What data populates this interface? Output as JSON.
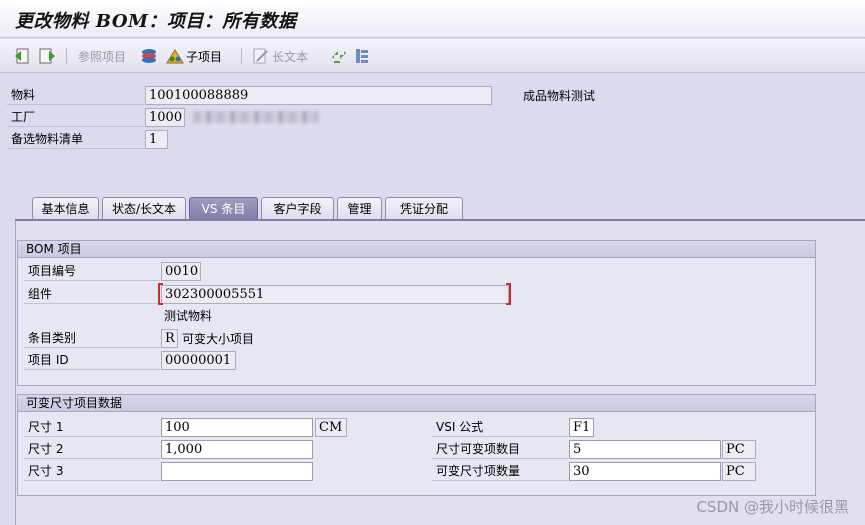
{
  "window": {
    "title": "更改物料 BOM：项目：所有数据"
  },
  "toolbar": {
    "ref_item_label": "参照项目",
    "sub_item_label": "子项目",
    "long_text_label": "长文本"
  },
  "header": {
    "material_label": "物料",
    "material_value": "100100088889",
    "material_desc": "成品物料测试",
    "plant_label": "工厂",
    "plant_value": "1000",
    "alt_bom_label": "备选物料清单",
    "alt_bom_value": "1"
  },
  "tabs": [
    {
      "label": "基本信息"
    },
    {
      "label": "状态/长文本"
    },
    {
      "label": "VS 条目"
    },
    {
      "label": "客户字段"
    },
    {
      "label": "管理"
    },
    {
      "label": "凭证分配"
    }
  ],
  "bom_item": {
    "heading": "BOM 项目",
    "item_no_label": "项目编号",
    "item_no_value": "0010",
    "component_label": "组件",
    "component_value": "302300005551",
    "component_desc": "测试物料",
    "category_label": "条目类别",
    "category_value": "R",
    "category_desc": "可变大小项目",
    "item_id_label": "项目 ID",
    "item_id_value": "00000001"
  },
  "vs_data": {
    "heading": "可变尺寸项目数据",
    "size1_label": "尺寸 1",
    "size1_value": "100",
    "size1_unit": "CM",
    "size2_label": "尺寸 2",
    "size2_value": "1,000",
    "size3_label": "尺寸 3",
    "size3_value": "",
    "vsi_label": "VSI 公式",
    "vsi_value": "F1",
    "qty_var_label": "尺寸可变项数目",
    "qty_var_value": "5",
    "qty_var_unit": "PC",
    "var_qty_label": "可变尺寸项数量",
    "var_qty_value": "30",
    "var_qty_unit": "PC"
  },
  "watermark": "CSDN @我小时候很黑"
}
